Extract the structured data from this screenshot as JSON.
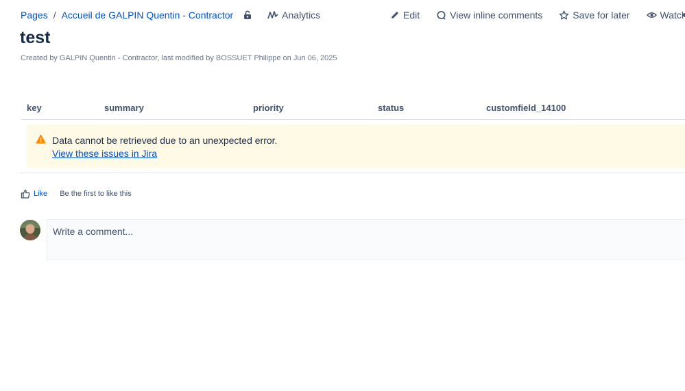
{
  "breadcrumb": {
    "pages": "Pages",
    "separator": "/",
    "space": "Accueil de GALPIN Quentin - Contractor"
  },
  "toolbar": {
    "analytics": "Analytics",
    "edit": "Edit",
    "view_inline_comments": "View inline comments",
    "save_for_later": "Save for later",
    "watch": "Watch"
  },
  "page": {
    "title": "test",
    "byline": "Created by GALPIN Quentin - Contractor, last modified by BOSSUET Philippe on Jun 06, 2025"
  },
  "jira_table": {
    "columns": [
      "key",
      "summary",
      "priority",
      "status",
      "customfield_14100"
    ],
    "error_message": "Data cannot be retrieved due to an unexpected error.",
    "link_text": "View these issues in Jira"
  },
  "likes": {
    "like_label": "Like",
    "like_text": "Be the first to like this"
  },
  "comment": {
    "placeholder": "Write a comment..."
  },
  "colors": {
    "link": "#0052cc",
    "text": "#172b4d",
    "warning_bg": "#fffae6",
    "warning_icon": "#ff8b00"
  }
}
